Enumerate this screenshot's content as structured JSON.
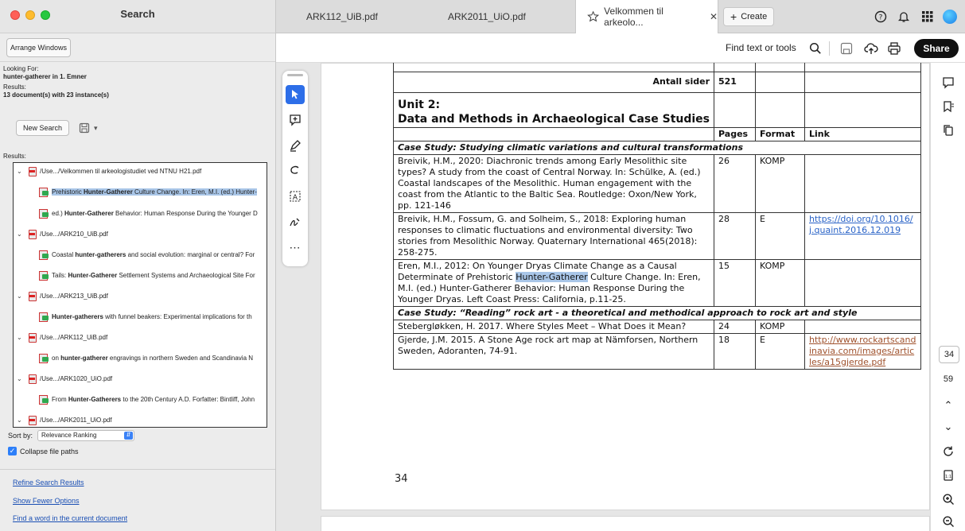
{
  "search_panel": {
    "title": "Search",
    "arrange_button": "Arrange Windows",
    "looking_for_label": "Looking For:",
    "looking_for_value": "hunter-gatherer in 1. Emner",
    "results_label": "Results:",
    "results_summary": "13 document(s) with 23 instance(s)",
    "new_search_button": "New Search",
    "results_list_label": "Results:",
    "results": [
      {
        "kind": "doc",
        "text": "/Use.../Velkommen til arkeologistudiet ved NTNU H21.pdf"
      },
      {
        "kind": "hit",
        "pre": "Prehistoric ",
        "match": "Hunter-Gatherer",
        "post": " Culture Change. In: Eren, M.I. (ed.) Hunter-",
        "selected": true
      },
      {
        "kind": "hit",
        "pre": "ed.) ",
        "match": "Hunter-Gatherer",
        "post": " Behavior: Human Response During the Younger D"
      },
      {
        "kind": "doc",
        "text": "/Use.../ARK210_UiB.pdf"
      },
      {
        "kind": "hit",
        "pre": "Coastal ",
        "match": "hunter-gatherers",
        "post": " and social evolution: marginal or central? For"
      },
      {
        "kind": "hit",
        "pre": "Tails: ",
        "match": "Hunter-Gatherer",
        "post": " Settlement Systems and Archaeological Site For"
      },
      {
        "kind": "doc",
        "text": "/Use.../ARK213_UiB.pdf"
      },
      {
        "kind": "hit",
        "pre": "",
        "match": "Hunter-gatherers",
        "post": " with funnel beakers: Experimental implications for th"
      },
      {
        "kind": "doc",
        "text": "/Use.../ARK112_UiB.pdf"
      },
      {
        "kind": "hit",
        "pre": "on ",
        "match": "hunter-gatherer",
        "post": " engravings in northern Sweden and Scandinavia N"
      },
      {
        "kind": "doc",
        "text": "/Use.../ARK1020_UiO.pdf"
      },
      {
        "kind": "hit",
        "pre": "From ",
        "match": "Hunter-Gatherers",
        "post": " to the 20th Century A.D. Forfatter: Bintliff, John"
      },
      {
        "kind": "doc",
        "text": "/Use.../ARK2011_UiO.pdf"
      }
    ],
    "sort_by_label": "Sort by:",
    "sort_by_value": "Relevance Ranking",
    "collapse_label": "Collapse file paths",
    "links": [
      "Refine Search Results",
      "Show Fewer Options",
      "Find a word in the current document"
    ]
  },
  "tabs": [
    {
      "label": "ARK112_UiB.pdf"
    },
    {
      "label": "ARK2011_UiO.pdf"
    },
    {
      "label": "Velkommen til arkeolo...",
      "active": true
    }
  ],
  "create_label": "Create",
  "toolbar": {
    "find_label": "Find text or tools",
    "share_label": "Share"
  },
  "document": {
    "antall_label": "Antall sider",
    "antall_value": "521",
    "unit_title_1": "Unit 2:",
    "unit_title_2": "Data and Methods in Archaeological Case Studies",
    "col_pages": "Pages",
    "col_format": "Format",
    "col_link": "Link",
    "case1": "Case Study: Studying climatic variations and cultural transformations",
    "rows1": [
      {
        "ref": "Breivik, H.M., 2020: Diachronic trends among Early Mesolithic site types? A study from the coast of Central Norway. In: Schülke, A. (ed.) Coastal landscapes of the Mesolithic. Human engagement with the coast from the Atlantic to the Baltic Sea. Routledge: Oxon/New York, pp. 121-146",
        "pages": "26",
        "format": "KOMP",
        "link": ""
      },
      {
        "ref": "Breivik, H.M., Fossum, G. and Solheim, S., 2018: Exploring human responses to climatic fluctuations and environmental diversity: Two stories from Mesolithic Norway. Quaternary International 465(2018): 258-275.",
        "pages": "28",
        "format": "E",
        "link": "https://doi.org/10.1016/j.quaint.2016.12.019"
      },
      {
        "ref_pre": "Eren, M.I., 2012: On Younger Dryas Climate Change as a Causal Determinate of Prehistoric ",
        "ref_hl": "Hunter-Gatherer",
        "ref_post": " Culture Change. In: Eren, M.I. (ed.) Hunter-Gatherer Behavior: Human Response During the Younger Dryas. Left Coast Press: California, p.11-25.",
        "pages": "15",
        "format": "KOMP",
        "link": ""
      }
    ],
    "case2": "Case Study: “Reading” rock art - a theoretical and methodical approach to rock art and style",
    "rows2": [
      {
        "ref": "Stebergløkken, H. 2017. Where Styles Meet – What Does it Mean?",
        "pages": "24",
        "format": "KOMP",
        "link": ""
      },
      {
        "ref": "Gjerde, J.M. 2015. A Stone Age rock art map at Nämforsen, Northern Sweden, Adoranten, 74-91.",
        "pages": "18",
        "format": "E",
        "link": "http://www.rockartscandinavia.com/images/articles/a15gjerde.pdf"
      }
    ],
    "page_number": "34"
  },
  "pager": {
    "current": "34",
    "total": "59"
  },
  "colors": {
    "accent": "#2d7ff9",
    "highlight": "#a9c6e8",
    "share_bg": "#111111"
  }
}
